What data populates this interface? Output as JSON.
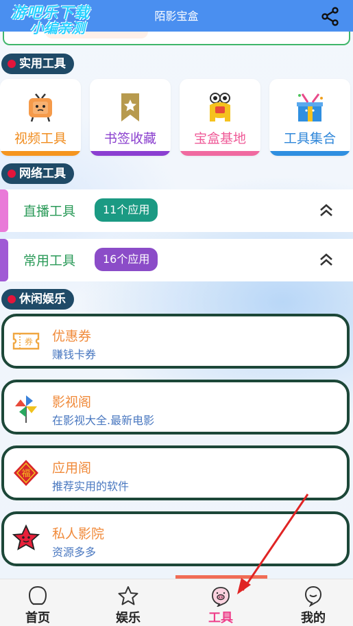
{
  "header": {
    "title": "陌影宝盒"
  },
  "watermark": {
    "line1": "游吧乐下载",
    "line2": "小编亲测"
  },
  "sections": {
    "practical": "实用工具",
    "network": "网络工具",
    "leisure": "休闲娱乐"
  },
  "tools": [
    {
      "label": "视频工具",
      "color": "#f08c1e",
      "bar": "#f5951f",
      "icon": "tv-icon"
    },
    {
      "label": "书签收藏",
      "color": "#8a3fce",
      "bar": "#8b3fd1",
      "icon": "bookmark-icon"
    },
    {
      "label": "宝盒基地",
      "color": "#ef5b98",
      "bar": "#f06aa0",
      "icon": "mascot-icon"
    },
    {
      "label": "工具集合",
      "color": "#2e86d9",
      "bar": "#2f8fe0",
      "icon": "gift-box-icon"
    }
  ],
  "network": [
    {
      "label": "直播工具",
      "badge": "11个应用",
      "side": "#e97ad8",
      "badge_color": "#1b9a83",
      "icon": "double-chevron-up-icon"
    },
    {
      "label": "常用工具",
      "badge": "16个应用",
      "side": "#a05ad5",
      "badge_color": "#8b4cc8",
      "icon": "double-chevron-up-icon"
    }
  ],
  "leisure": [
    {
      "title": "优惠券",
      "subtitle": "赚钱卡券",
      "icon": "coupon-icon"
    },
    {
      "title": "影视阁",
      "subtitle": "在影视大全.最新电影",
      "icon": "pinwheel-icon"
    },
    {
      "title": "应用阁",
      "subtitle": "推荐实用的软件",
      "icon": "fortune-icon"
    },
    {
      "title": "私人影院",
      "subtitle": "资源多多",
      "icon": "star-face-icon"
    }
  ],
  "nav": [
    {
      "label": "首页",
      "icon": "home-bubble-icon",
      "active": false
    },
    {
      "label": "娱乐",
      "icon": "star-icon",
      "active": false
    },
    {
      "label": "工具",
      "icon": "pig-icon",
      "active": true
    },
    {
      "label": "我的",
      "icon": "profile-icon",
      "active": false
    }
  ],
  "colors": {
    "header": "#4a8ff0",
    "section_pill": "#1f4a67",
    "card_border": "#1c4738",
    "arrow": "#e02424"
  }
}
